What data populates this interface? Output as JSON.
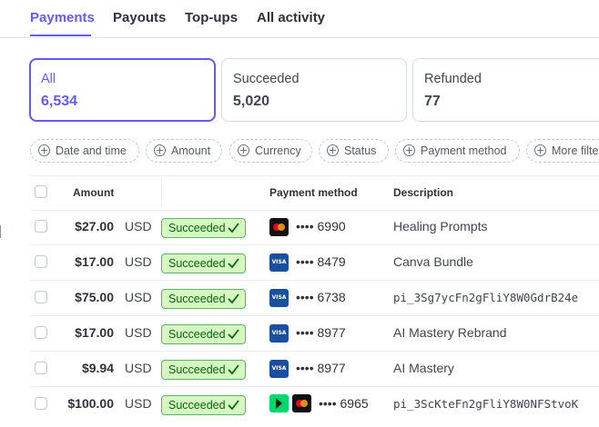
{
  "tabs": [
    {
      "label": "Payments",
      "active": true
    },
    {
      "label": "Payouts"
    },
    {
      "label": "Top-ups"
    },
    {
      "label": "All activity"
    }
  ],
  "counts": [
    {
      "label": "All",
      "value": "6,534",
      "selected": true
    },
    {
      "label": "Succeeded",
      "value": "5,020"
    },
    {
      "label": "Refunded",
      "value": "77"
    }
  ],
  "filters": [
    "Date and time",
    "Amount",
    "Currency",
    "Status",
    "Payment method",
    "More filters"
  ],
  "table": {
    "headers": {
      "amount": "Amount",
      "payment_method": "Payment method",
      "description": "Description"
    },
    "rows": [
      {
        "amount": "$27.00",
        "currency": "USD",
        "status": "Succeeded",
        "brand": "mastercard",
        "last4": "•••• 6990",
        "description": "Healing Prompts"
      },
      {
        "amount": "$17.00",
        "currency": "USD",
        "status": "Succeeded",
        "brand": "visa",
        "last4": "•••• 8479",
        "description": "Canva Bundle"
      },
      {
        "amount": "$75.00",
        "currency": "USD",
        "status": "Succeeded",
        "brand": "visa",
        "last4": "•••• 6738",
        "description": "pi_3Sg7ycFn2gFliY8W0GdrB24e"
      },
      {
        "amount": "$17.00",
        "currency": "USD",
        "status": "Succeeded",
        "brand": "visa",
        "last4": "•••• 8977",
        "description": "AI Mastery Rebrand"
      },
      {
        "amount": "$9.94",
        "currency": "USD",
        "status": "Succeeded",
        "brand": "visa",
        "last4": "•••• 8977",
        "description": "AI Mastery"
      },
      {
        "amount": "$100.00",
        "currency": "USD",
        "status": "Succeeded",
        "brand": "link+mastercard",
        "last4": "•••• 6965",
        "description": "pi_3ScKteFn2gFliY8W0NFStvoK"
      }
    ]
  },
  "icons": {
    "visa_text": "VISA"
  },
  "colors": {
    "accent": "#635bff",
    "success_bg": "#d7f7c2",
    "success_text": "#05690d",
    "link_green": "#00d66f"
  }
}
